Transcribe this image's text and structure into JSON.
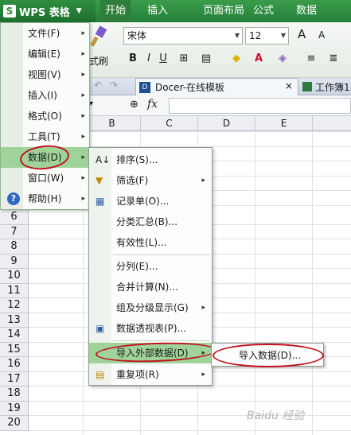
{
  "app": {
    "logo": "S",
    "name": "WPS 表格",
    "caret": "▼"
  },
  "ribbon_tabs": [
    "开始",
    "插入",
    "页面布局",
    "公式",
    "数据"
  ],
  "toolbar": {
    "format_brush_label": "式刷",
    "font_name": "宋体",
    "font_size": "12",
    "bold": "B",
    "italic": "I",
    "underline": "U",
    "grow_font": "A",
    "shrink_font": "A"
  },
  "doc_tabs": {
    "docer_icon": "D",
    "docer_label": "Docer-在线模板",
    "close": "×",
    "workbook_label": "工作簿1"
  },
  "formula_bar": {
    "fx": "fx"
  },
  "columns": [
    "B",
    "C",
    "D",
    "E"
  ],
  "rows": [
    "6",
    "7",
    "8",
    "9",
    "10",
    "11",
    "12",
    "13",
    "14",
    "15",
    "16",
    "17",
    "18",
    "19",
    "20"
  ],
  "app_menu": [
    {
      "label": "文件(F)",
      "arrow": "▸"
    },
    {
      "label": "编辑(E)",
      "arrow": "▸"
    },
    {
      "label": "视图(V)",
      "arrow": "▸"
    },
    {
      "label": "插入(I)",
      "arrow": "▸"
    },
    {
      "label": "格式(O)",
      "arrow": "▸"
    },
    {
      "label": "工具(T)",
      "arrow": "▸"
    },
    {
      "label": "数据(D)",
      "arrow": "▸"
    },
    {
      "label": "窗口(W)",
      "arrow": "▸"
    },
    {
      "label": "帮助(H)",
      "arrow": "▸",
      "icon": "?"
    }
  ],
  "data_menu": [
    {
      "label": "排序(S)...",
      "icon": "sort-icon"
    },
    {
      "label": "筛选(F)",
      "icon": "filter-icon",
      "arrow": "▸"
    },
    {
      "label": "记录单(O)...",
      "icon": "form-icon"
    },
    {
      "label": "分类汇总(B)..."
    },
    {
      "label": "有效性(L)..."
    },
    {
      "label": "分列(E)..."
    },
    {
      "label": "合并计算(N)..."
    },
    {
      "label": "组及分级显示(G)",
      "arrow": "▸"
    },
    {
      "label": "数据透视表(P)...",
      "icon": "pivot-icon"
    },
    {
      "label": "导入外部数据(D)",
      "arrow": "▸"
    },
    {
      "label": "重复项(R)",
      "icon": "duplicate-icon",
      "arrow": "▸"
    }
  ],
  "import_menu": {
    "label": "导入数据(D)..."
  },
  "watermark": "Baidu 经验"
}
